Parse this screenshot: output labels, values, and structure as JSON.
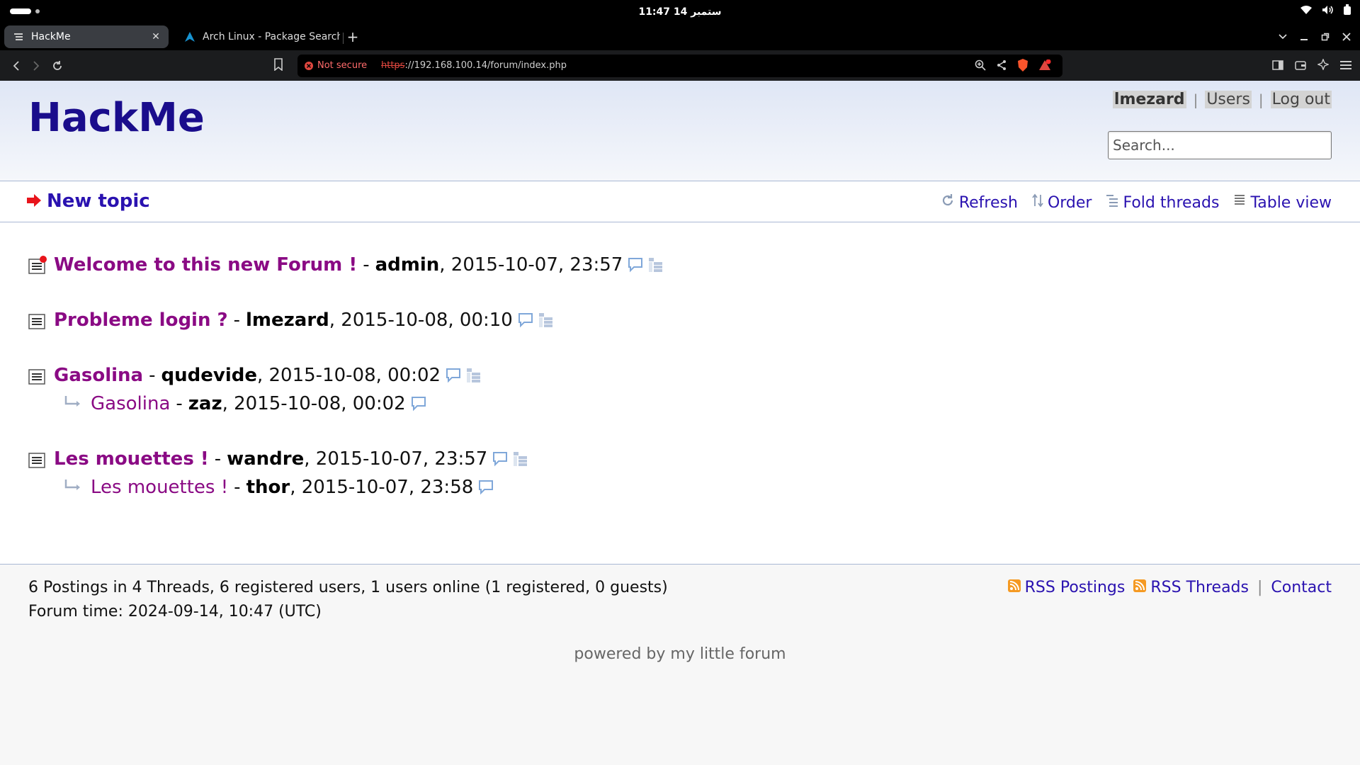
{
  "os": {
    "clock": "11:47 14 ستمبر"
  },
  "browser": {
    "tabs": [
      {
        "title": "HackMe",
        "active": true
      },
      {
        "title": "Arch Linux - Package Search",
        "active": false
      }
    ],
    "new_tab_label": "+",
    "security_label": "Not secure",
    "url_scheme": "https",
    "url_rest": "://192.168.100.14/forum/index.php"
  },
  "site": {
    "title": "HackMe",
    "user_nav": {
      "username": "lmezard",
      "users": "Users",
      "logout": "Log out"
    },
    "search_placeholder": "Search..."
  },
  "subnav": {
    "new_topic": "New topic",
    "refresh": "Refresh",
    "order": "Order",
    "fold_threads": "Fold threads",
    "table_view": "Table view"
  },
  "threads": [
    {
      "title": "Welcome to this new Forum !",
      "author": "admin",
      "date": "2015-10-07, 23:57",
      "new": true,
      "replies": []
    },
    {
      "title": "Probleme login ?",
      "author": "lmezard",
      "date": "2015-10-08, 00:10",
      "new": false,
      "replies": []
    },
    {
      "title": "Gasolina",
      "author": "qudevide",
      "date": "2015-10-08, 00:02",
      "new": false,
      "replies": [
        {
          "title": "Gasolina",
          "author": "zaz",
          "date": "2015-10-08, 00:02"
        }
      ]
    },
    {
      "title": "Les mouettes !",
      "author": "wandre",
      "date": "2015-10-07, 23:57",
      "new": false,
      "replies": [
        {
          "title": "Les mouettes !",
          "author": "thor",
          "date": "2015-10-07, 23:58"
        }
      ]
    }
  ],
  "footer": {
    "stats": "6 Postings in 4 Threads, 6 registered users, 1 users online (1 registered, 0 guests)",
    "forum_time": "Forum time: 2024-09-14, 10:47 (UTC)",
    "rss_postings": "RSS Postings",
    "rss_threads": "RSS Threads",
    "contact": "Contact",
    "powered_by": "powered by my little forum"
  },
  "colors": {
    "link": "#2a12b0",
    "topic": "#8a0a84",
    "site_title": "#1a0d8c"
  }
}
